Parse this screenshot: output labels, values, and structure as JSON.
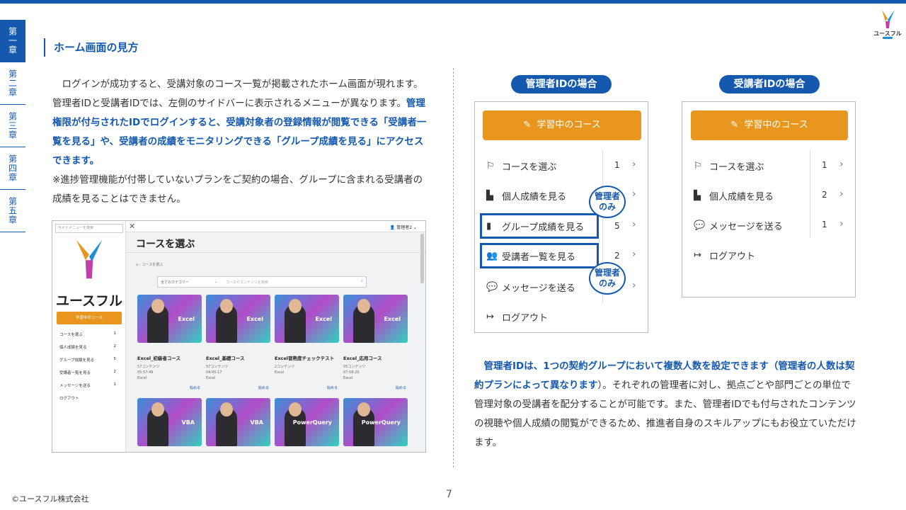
{
  "chapters": [
    "第一章",
    "第二章",
    "第三章",
    "第四章",
    "第五章"
  ],
  "logo": {
    "text": "ユースフル"
  },
  "section_title": "ホーム画面の見方",
  "intro": {
    "p1": "ログインが成功すると、受講対象のコース一覧が掲載されたホーム画面が現れます。管理者IDと受講者IDでは、左側のサイドバーに表示されるメニューが異なります。",
    "p1_em": "管理権限が付与されたIDでログインすると、受講対象者の登録情報が閲覧できる「受講者一覧を見る」や、受講者の成績をモニタリングできる「グループ成績を見る」にアクセスできます。",
    "p2": "※進捗管理機能が付帯していないプランをご契約の場合、グループに含まれる受講者の成績を見ることはできません。"
  },
  "screenshot": {
    "search_placeholder": "サイドメニューを検索",
    "brand": "ユースフル",
    "study_btn": "学習中のコース",
    "side_items": [
      {
        "label": "コースを選ぶ",
        "count": "1"
      },
      {
        "label": "個人成績を見る",
        "count": "2"
      },
      {
        "label": "グループ成績を見る",
        "count": "5"
      },
      {
        "label": "受講者一覧を見る",
        "count": "2"
      },
      {
        "label": "メッセージを送る",
        "count": "1"
      },
      {
        "label": "ログアウト",
        "count": ""
      }
    ],
    "user": "管理者2",
    "page_title": "コースを選ぶ",
    "breadcrumb": "コースを選ぶ",
    "category": "全てのカテゴリー",
    "keyword_placeholder": "コースやコンテンツを検索",
    "courses": [
      {
        "label": "Excel",
        "title": "Excel_初級者コース",
        "contents": "17コンテンツ",
        "time": "05:57:49",
        "tag": "Excel",
        "action": "始める"
      },
      {
        "label": "Excel",
        "title": "Excel_基礎コース",
        "contents": "57コンテンツ",
        "time": "04:45:17",
        "tag": "Excel",
        "action": "始める"
      },
      {
        "label": "Excel",
        "title": "Excel習熟度チェックテスト",
        "contents": "2コンテンツ",
        "time": "",
        "tag": "Excel",
        "action": "始める"
      },
      {
        "label": "Excel",
        "title": "Excel_応用コース",
        "contents": "55コンテンツ",
        "time": "07:58:20",
        "tag": "Excel",
        "action": "始める"
      },
      {
        "label": "VBA",
        "title": "",
        "contents": "",
        "time": "",
        "tag": "",
        "action": ""
      },
      {
        "label": "VBA",
        "title": "",
        "contents": "",
        "time": "",
        "tag": "",
        "action": ""
      },
      {
        "label": "PowerQuery",
        "title": "",
        "contents": "",
        "time": "",
        "tag": "",
        "action": ""
      },
      {
        "label": "PowerQuery",
        "title": "",
        "contents": "",
        "time": "",
        "tag": "",
        "action": ""
      }
    ]
  },
  "admin_panel": {
    "pill": "管理者IDの場合",
    "study_btn": "学習中のコース",
    "items": [
      {
        "label": "コースを選ぶ",
        "count": "1"
      },
      {
        "label": "個人成績を見る",
        "count": ""
      },
      {
        "label": "グループ成績を見る",
        "count": "5"
      },
      {
        "label": "受講者一覧を見る",
        "count": "2"
      },
      {
        "label": "メッセージを送る",
        "count": ""
      },
      {
        "label": "ログアウト",
        "count": ""
      }
    ],
    "bubble_line1": "管理者",
    "bubble_line2": "のみ"
  },
  "learner_panel": {
    "pill": "受講者IDの場合",
    "study_btn": "学習中のコース",
    "items": [
      {
        "label": "コースを選ぶ",
        "count": "1"
      },
      {
        "label": "個人成績を見る",
        "count": "2"
      },
      {
        "label": "メッセージを送る",
        "count": "1"
      },
      {
        "label": "ログアウト",
        "count": ""
      }
    ]
  },
  "note": {
    "em": "管理者IDは、1つの契約グループにおいて複数人数を設定できます（管理者の人数は契約プランによって異なります",
    "rest": "）。それぞれの管理者に対し、拠点ごとや部門ごとの単位で管理対象の受講者を配分することが可能です。また、管理者IDでも付与されたコンテンツの視聴や個人成績の閲覧ができるため、推進者自身のスキルアップにもお役立ていただけます。"
  },
  "page_number": "7",
  "copyright": "©ユースフル株式会社",
  "colors": {
    "brand_blue": "#1459ad",
    "orange": "#e8961e"
  }
}
